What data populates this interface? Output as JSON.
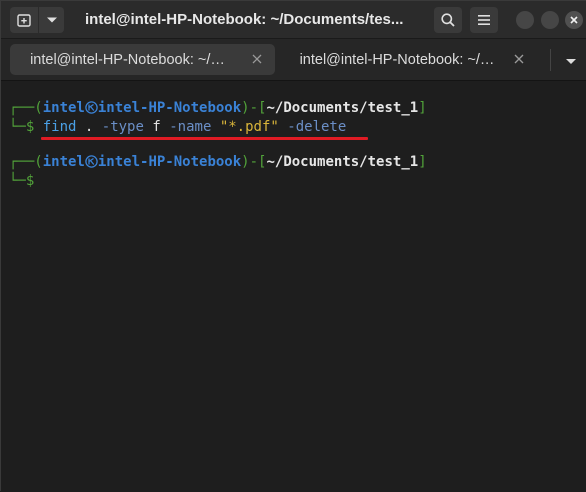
{
  "window": {
    "title": "intel@intel-HP-Notebook: ~/Documents/tes..."
  },
  "tabs": [
    {
      "label": "intel@intel-HP-Notebook: ~/…",
      "active": true
    },
    {
      "label": "intel@intel-HP-Notebook: ~/…",
      "active": false
    }
  ],
  "icons": {
    "new_tab": "new-tab-icon",
    "dropdown": "chevron-down-icon",
    "search": "search-icon",
    "menu": "hamburger-menu-icon",
    "minimize": "minimize-icon",
    "maximize": "maximize-icon",
    "close": "close-icon"
  },
  "terminal": {
    "prompt1": {
      "open": "┌──(",
      "user": "intel",
      "host": "intel-HP-Notebook",
      "mid": ")-[",
      "path": "~/Documents/test_1",
      "close": "]"
    },
    "command_line": {
      "prefix": "└─",
      "dollar": "$",
      "cmd": "find",
      "arg1": ".",
      "opt1": "-type",
      "arg2": "f",
      "opt2": "-name",
      "str": "\"*.pdf\"",
      "opt3": "-delete"
    },
    "prompt2": {
      "open": "┌──(",
      "user": "intel",
      "host": "intel-HP-Notebook",
      "mid": ")-[",
      "path": "~/Documents/test_1",
      "close": "]"
    },
    "cursor_line": {
      "prefix": "└─",
      "dollar": "$"
    }
  },
  "colors": {
    "prompt_frame": "#52a33a",
    "user_host": "#3a82d6",
    "path": "#e6e6e6",
    "string": "#d9b53a",
    "highlight_underline": "#e01b24"
  }
}
